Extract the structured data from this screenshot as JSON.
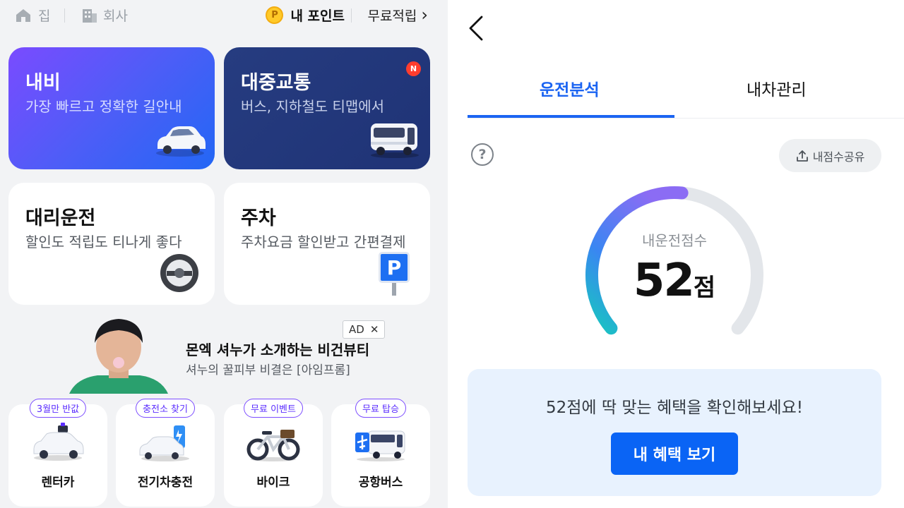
{
  "topbar": {
    "home_label": "집",
    "work_label": "회사",
    "coin_symbol": "P",
    "points_label": "내 포인트",
    "free_label": "무료적립",
    "free_chevron": "›"
  },
  "cards": {
    "navigation": {
      "title": "내비",
      "subtitle": "가장 빠르고 정확한 길안내"
    },
    "transit": {
      "title": "대중교통",
      "subtitle": "버스, 지하철도 티맵에서",
      "badge": "N"
    },
    "driver": {
      "title": "대리운전",
      "subtitle": "할인도 적립도 티나게 좋다"
    },
    "parking": {
      "title": "주차",
      "subtitle": "주차요금 할인받고 간편결제",
      "sign_letter": "P"
    }
  },
  "ad": {
    "title": "몬엑 셔누가 소개하는 비건뷰티",
    "subtitle": "셔누의 꿀피부 비결은 [아임프롬]",
    "badge": "AD",
    "close": "✕"
  },
  "services": [
    {
      "pill": "3월만 반값",
      "label": "렌터카",
      "icon": "rental-car-icon"
    },
    {
      "pill": "충전소 찾기",
      "label": "전기차충전",
      "icon": "ev-charging-icon"
    },
    {
      "pill": "무료 이벤트",
      "label": "바이크",
      "icon": "bike-icon"
    },
    {
      "pill": "무료 탑승",
      "label": "공항버스",
      "icon": "airport-bus-icon"
    }
  ],
  "right": {
    "tabs": [
      {
        "label": "운전분석",
        "active": true
      },
      {
        "label": "내차관리",
        "active": false
      }
    ],
    "help_symbol": "?",
    "share_label": "내점수공유",
    "gauge": {
      "label": "내운전점수",
      "score": "52",
      "unit": "점",
      "score_value": 52,
      "score_max": 100
    },
    "benefit": {
      "text": "52점에 딱 맞는 혜택을 확인해보세요!",
      "button_label": "내 혜택 보기"
    }
  },
  "colors": {
    "accent": "#1b64f2",
    "nav_gradient_start": "#7a4bff",
    "nav_gradient_end": "#2367f5",
    "transit_bg": "#263c80",
    "gauge_start": "#18c6c0",
    "gauge_end": "#8b6cf4",
    "gauge_track": "#e3e6ea",
    "benefit_bg": "#e8f2fe",
    "button_bg": "#0a64f5"
  }
}
